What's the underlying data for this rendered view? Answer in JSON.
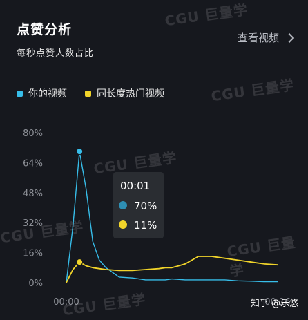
{
  "header": {
    "title": "点赞分析",
    "subtitle": "每秒点赞人数占比",
    "view_link": "查看视频"
  },
  "watermark": "CGU 巨量学",
  "credit": "知乎 @乐悠",
  "colors": {
    "background": "#16181e",
    "your_video": "#37bde9",
    "similar_hot": "#f1d42a",
    "tooltip_bg": "#2c2e33"
  },
  "tooltip": {
    "time": "00:01",
    "your_value": "70%",
    "similar_value": "11%"
  },
  "chart_data": {
    "type": "line",
    "x": [
      0,
      0.5,
      1,
      1.5,
      2,
      2.5,
      3,
      4,
      5,
      6,
      7,
      7.5,
      8,
      9,
      10,
      11,
      12,
      13,
      14,
      15,
      16
    ],
    "x_tick_labels": [
      "00:00",
      "00:16"
    ],
    "yticks": [
      "80%",
      "64%",
      "48%",
      "32%",
      "16%",
      "0%"
    ],
    "ylim": [
      0,
      80
    ],
    "series": [
      {
        "name": "你的视频",
        "color": "#37bde9",
        "values": [
          0,
          30,
          70,
          50,
          22,
          12,
          8,
          3,
          2.5,
          1.5,
          1.5,
          1.5,
          2,
          1.5,
          1.5,
          1.5,
          1.5,
          1,
          0.8,
          0.5,
          0.5
        ]
      },
      {
        "name": "同长度热门视频",
        "color": "#f1d42a",
        "values": [
          0,
          7,
          11,
          9,
          8,
          7.5,
          7,
          6.5,
          6.5,
          7,
          7.5,
          8,
          8,
          10,
          14,
          14,
          13,
          12,
          11,
          10,
          9.5
        ]
      }
    ],
    "legend": "top-left",
    "grid": false
  }
}
